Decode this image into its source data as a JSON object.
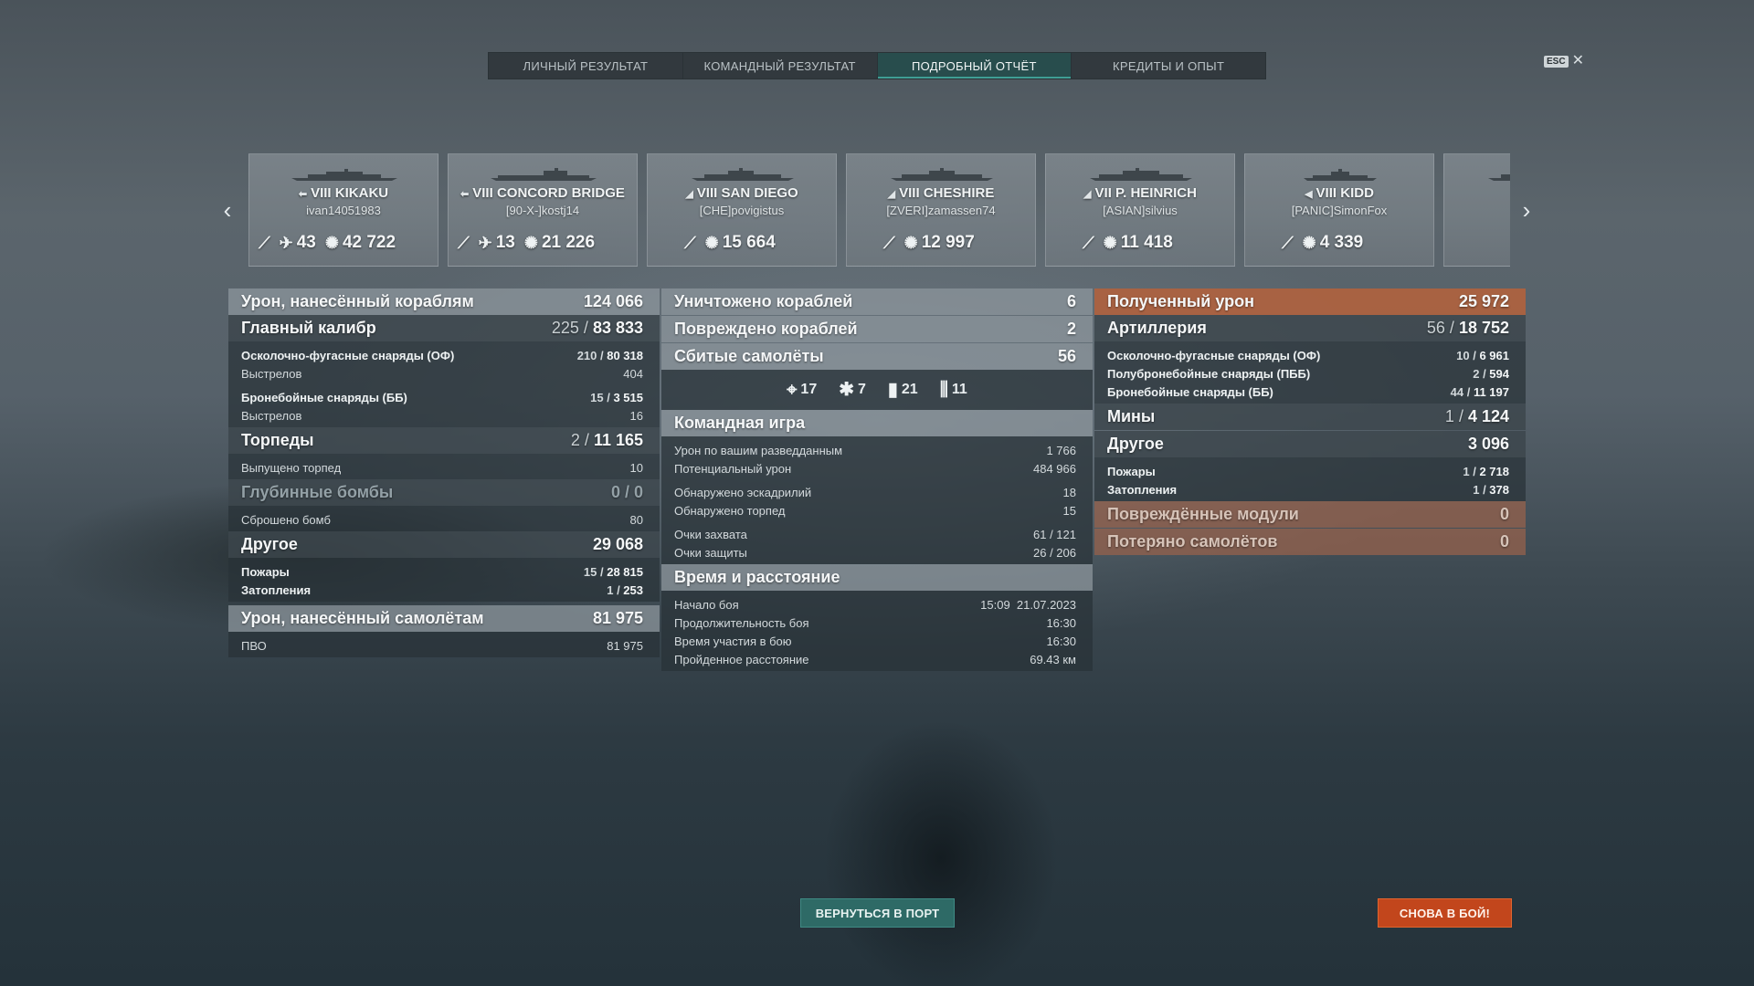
{
  "tabs": [
    {
      "label": "ЛИЧНЫЙ РЕЗУЛЬТАТ",
      "active": false
    },
    {
      "label": "КОМАНДНЫЙ РЕЗУЛЬТАТ",
      "active": false
    },
    {
      "label": "ПОДРОБНЫЙ ОТЧЁТ",
      "active": true
    },
    {
      "label": "КРЕДИТЫ И ОПЫТ",
      "active": false
    }
  ],
  "esc": {
    "key": "ESC",
    "close": "✕"
  },
  "ships": [
    {
      "tier": "VIII",
      "name": "KIKAKU",
      "player": "ivan14051983",
      "planes": "43",
      "damage": "42 722"
    },
    {
      "tier": "VIII",
      "name": "CONCORD BRIDGE",
      "player": "[90-X-]kostj14",
      "planes": "13",
      "damage": "21 226"
    },
    {
      "tier": "VIII",
      "name": "SAN DIEGO",
      "player": "[CHE]povigistus",
      "damage": "15 664"
    },
    {
      "tier": "VIII",
      "name": "CHESHIRE",
      "player": "[ZVERI]zamassen74",
      "damage": "12 997"
    },
    {
      "tier": "VII",
      "name": "P. HEINRICH",
      "player": "[ASIAN]silvius",
      "damage": "11 418"
    },
    {
      "tier": "VIII",
      "name": "KIDD",
      "player": "[PANIC]SimonFox",
      "damage": "4 339"
    }
  ],
  "col1": {
    "ship_damage": {
      "label": "Урон, нанесённый кораблям",
      "value": "124 066"
    },
    "main_battery": {
      "label": "Главный калибр",
      "hits": "225",
      "damage": "83 833"
    },
    "he": {
      "label": "Осколочно-фугасные снаряды (ОФ)",
      "hits": "210",
      "damage": "80 318"
    },
    "he_shots": {
      "label": "Выстрелов",
      "value": "404"
    },
    "ap": {
      "label": "Бронебойные снаряды (ББ)",
      "hits": "15",
      "damage": "3 515"
    },
    "ap_shots": {
      "label": "Выстрелов",
      "value": "16"
    },
    "torpedoes": {
      "label": "Торпеды",
      "hits": "2",
      "damage": "11 165"
    },
    "torp_fired": {
      "label": "Выпущено торпед",
      "value": "10"
    },
    "depth": {
      "label": "Глубинные бомбы",
      "hits": "0",
      "damage": "0"
    },
    "depth_dropped": {
      "label": "Сброшено бомб",
      "value": "80"
    },
    "other": {
      "label": "Другое",
      "value": "29 068"
    },
    "fires": {
      "label": "Пожары",
      "hits": "15",
      "damage": "28 815"
    },
    "floods": {
      "label": "Затопления",
      "hits": "1",
      "damage": "253"
    },
    "plane_damage": {
      "label": "Урон, нанесённый самолётам",
      "value": "81 975"
    },
    "aa": {
      "label": "ПВО",
      "value": "81 975"
    }
  },
  "col2": {
    "destroyed": {
      "label": "Уничтожено кораблей",
      "value": "6"
    },
    "damaged": {
      "label": "Повреждено кораблей",
      "value": "2"
    },
    "planes_down": {
      "label": "Сбитые самолёты",
      "value": "56"
    },
    "plane_types": [
      {
        "icon": "fighter-icon",
        "value": "17"
      },
      {
        "icon": "dive-bomber-icon",
        "value": "7"
      },
      {
        "icon": "bomb-icon",
        "value": "21"
      },
      {
        "icon": "torpedo-bomber-icon",
        "value": "11"
      }
    ],
    "teamplay": {
      "label": "Командная игра"
    },
    "spotting_damage": {
      "label": "Урон по вашим разведданным",
      "value": "1 766"
    },
    "potential_damage": {
      "label": "Потенциальный урон",
      "value": "484 966"
    },
    "squadrons_spotted": {
      "label": "Обнаружено эскадрилий",
      "value": "18"
    },
    "torps_spotted": {
      "label": "Обнаружено торпед",
      "value": "15"
    },
    "capture": {
      "label": "Очки захвата",
      "value": "61 / 121"
    },
    "defense": {
      "label": "Очки защиты",
      "value": "26 / 206"
    },
    "time": {
      "label": "Время и расстояние"
    },
    "battle_start": {
      "label": "Начало боя",
      "value": "15:09  21.07.2023"
    },
    "duration": {
      "label": "Продолжительность боя",
      "value": "16:30"
    },
    "participation": {
      "label": "Время участия в бою",
      "value": "16:30"
    },
    "distance": {
      "label": "Пройденное расстояние",
      "value": "69.43 км"
    }
  },
  "col3": {
    "received": {
      "label": "Полученный урон",
      "value": "25 972"
    },
    "artillery": {
      "label": "Артиллерия",
      "hits": "56",
      "damage": "18 752"
    },
    "he": {
      "label": "Осколочно-фугасные снаряды (ОФ)",
      "hits": "10",
      "damage": "6 961"
    },
    "sap": {
      "label": "Полубронебойные снаряды (ПББ)",
      "hits": "2",
      "damage": "594"
    },
    "ap": {
      "label": "Бронебойные снаряды (ББ)",
      "hits": "44",
      "damage": "11 197"
    },
    "mines": {
      "label": "Мины",
      "hits": "1",
      "damage": "4 124"
    },
    "other": {
      "label": "Другое",
      "value": "3 096"
    },
    "fires": {
      "label": "Пожары",
      "hits": "1",
      "damage": "2 718"
    },
    "floods": {
      "label": "Затопления",
      "hits": "1",
      "damage": "378"
    },
    "modules": {
      "label": "Повреждённые модули",
      "value": "0"
    },
    "planes_lost": {
      "label": "Потеряно самолётов",
      "value": "0"
    }
  },
  "buttons": {
    "port": "ВЕРНУТЬСЯ В ПОРТ",
    "battle": "СНОВА В БОЙ!"
  },
  "colors": {
    "accent": "#2e6a66",
    "battle": "#c2461c",
    "received": "#b0623e"
  }
}
